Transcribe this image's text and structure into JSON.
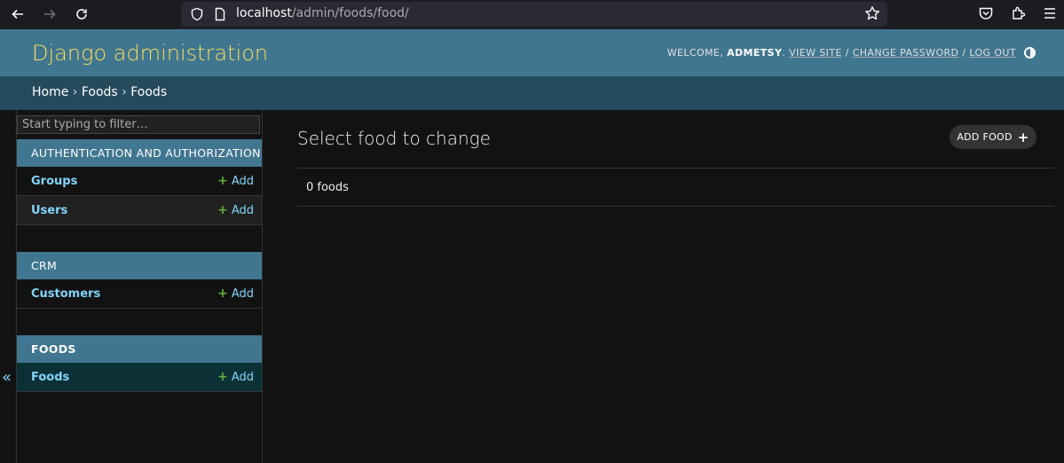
{
  "browser": {
    "url_host": "localhost",
    "url_path": "/admin/foods/food/"
  },
  "header": {
    "branding": "Django administration",
    "welcome": "WELCOME,",
    "username": "ADMETSY",
    "view_site": "VIEW SITE",
    "change_password": "CHANGE PASSWORD",
    "log_out": "LOG OUT",
    "separator": "/"
  },
  "breadcrumbs": {
    "home": "Home",
    "app": "Foods",
    "current": "Foods",
    "sep": "›"
  },
  "sidebar": {
    "filter_placeholder": "Start typing to filter…",
    "collapse_label": "«",
    "modules": [
      {
        "caption": "AUTHENTICATION AND AUTHORIZATION",
        "models": [
          {
            "name": "Groups",
            "add": "Add"
          },
          {
            "name": "Users",
            "add": "Add"
          }
        ]
      },
      {
        "caption": "CRM",
        "models": [
          {
            "name": "Customers",
            "add": "Add"
          }
        ]
      },
      {
        "caption": "FOODS",
        "models": [
          {
            "name": "Foods",
            "add": "Add"
          }
        ]
      }
    ]
  },
  "content": {
    "title": "Select food to change",
    "add_button": "ADD FOOD",
    "result_count": "0 foods"
  },
  "colors": {
    "header_bg": "#417690",
    "branding": "#f5dd5d",
    "breadcrumbs_bg": "#264b5d",
    "link": "#81d4fa",
    "add_plus": "#5fad3a"
  }
}
